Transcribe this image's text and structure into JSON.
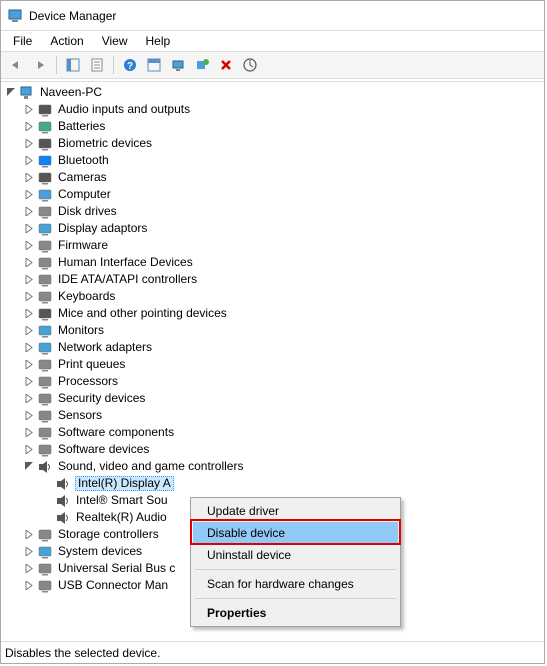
{
  "window": {
    "title": "Device Manager"
  },
  "menus": {
    "file": "File",
    "action": "Action",
    "view": "View",
    "help": "Help"
  },
  "toolbar": {
    "back": "back-icon",
    "forward": "forward-icon",
    "show": "show-hide-icon",
    "props": "properties-icon",
    "help": "help-icon",
    "showhidden": "show-hidden-icon",
    "monitor": "monitor-icon",
    "addhw": "add-hardware-icon",
    "remove": "remove-icon",
    "scan": "scan-hardware-icon"
  },
  "root": {
    "label": "Naveen-PC"
  },
  "categories": [
    {
      "label": "Audio inputs and outputs",
      "iconColor": "#555"
    },
    {
      "label": "Batteries",
      "iconColor": "#4a8"
    },
    {
      "label": "Biometric devices",
      "iconColor": "#555"
    },
    {
      "label": "Bluetooth",
      "iconColor": "#0a84ff"
    },
    {
      "label": "Cameras",
      "iconColor": "#555"
    },
    {
      "label": "Computer",
      "iconColor": "#4aa0d8"
    },
    {
      "label": "Disk drives",
      "iconColor": "#888"
    },
    {
      "label": "Display adaptors",
      "iconColor": "#4aa0d8"
    },
    {
      "label": "Firmware",
      "iconColor": "#888"
    },
    {
      "label": "Human Interface Devices",
      "iconColor": "#888"
    },
    {
      "label": "IDE ATA/ATAPI controllers",
      "iconColor": "#888"
    },
    {
      "label": "Keyboards",
      "iconColor": "#888"
    },
    {
      "label": "Mice and other pointing devices",
      "iconColor": "#555"
    },
    {
      "label": "Monitors",
      "iconColor": "#4aa0d8"
    },
    {
      "label": "Network adapters",
      "iconColor": "#4aa0d8"
    },
    {
      "label": "Print queues",
      "iconColor": "#888"
    },
    {
      "label": "Processors",
      "iconColor": "#888"
    },
    {
      "label": "Security devices",
      "iconColor": "#888"
    },
    {
      "label": "Sensors",
      "iconColor": "#888"
    },
    {
      "label": "Software components",
      "iconColor": "#888"
    },
    {
      "label": "Software devices",
      "iconColor": "#888"
    }
  ],
  "expanded": {
    "label": "Sound, video and game controllers",
    "children": [
      {
        "label": "Intel(R) Display A"
      },
      {
        "label": "Intel® Smart Sou"
      },
      {
        "label": "Realtek(R) Audio"
      }
    ]
  },
  "after": [
    {
      "label": "Storage controllers",
      "iconColor": "#888"
    },
    {
      "label": "System devices",
      "iconColor": "#4aa0d8"
    },
    {
      "label": "Universal Serial Bus c",
      "iconColor": "#888"
    },
    {
      "label": "USB Connector Man",
      "iconColor": "#888"
    }
  ],
  "context": {
    "update": "Update driver",
    "disable": "Disable device",
    "uninstall": "Uninstall device",
    "scan": "Scan for hardware changes",
    "properties": "Properties"
  },
  "status": "Disables the selected device."
}
